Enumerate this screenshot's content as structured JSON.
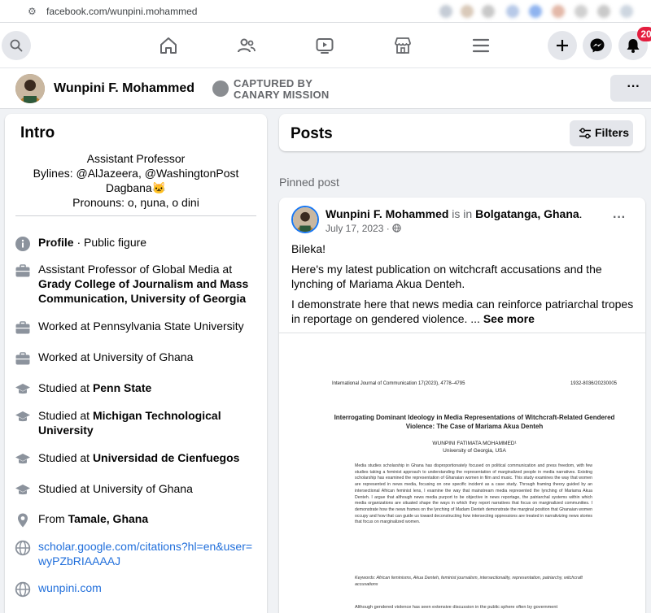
{
  "browser": {
    "url": "facebook.com/wunpini.mohammed"
  },
  "nav": {
    "notification_count": "20"
  },
  "profile": {
    "name": "Wunpini F. Mohammed"
  },
  "stamp": {
    "line1": "CAPTURED BY",
    "line2": "CANARY MISSION"
  },
  "intro": {
    "title": "Intro",
    "bio": [
      "Assistant Professor",
      "Bylines: @AlJazeera, @WashingtonPost",
      "Dagbana🐱",
      "Pronouns: o, ŋuna, o dini"
    ],
    "profile_label": "Profile",
    "profile_suffix": " · Public figure",
    "work1_prefix": "Assistant Professor of Global Media at ",
    "work1_bold": "Grady College of Journalism and Mass Communication, University of Georgia",
    "work2": "Worked at Pennsylvania State University",
    "work3": "Worked at University of Ghana",
    "edu1_prefix": "Studied at ",
    "edu1_bold": "Penn State",
    "edu2_prefix": "Studied at ",
    "edu2_bold": "Michigan Technological University",
    "edu3_prefix": "Studied at ",
    "edu3_bold": "Universidad de Cienfuegos",
    "edu4": "Studied at University of Ghana",
    "from_prefix": "From ",
    "from_bold": "Tamale, Ghana",
    "link1": "scholar.google.com/citations?hl=en&user=wyPZbRIAAAAJ",
    "link2": "wunpini.com"
  },
  "posts": {
    "title": "Posts",
    "filters_label": "Filters",
    "pinned_label": "Pinned post",
    "author": "Wunpini F. Mohammed",
    "is_in": " is in ",
    "location": "Bolgatanga, Ghana",
    "period": ".",
    "date": "July 17, 2023 · ",
    "p1": "Bileka!",
    "p2": "Here's my latest publication on witchcraft accusations and the lynching of Mariama Akua Denteh.",
    "p3": "I demonstrate here that news media can reinforce patriarchal tropes in reportage on gendered violence. ...",
    "see_more": " See more"
  },
  "document": {
    "journal": "International Journal of Communication 17(2023), 4778–4795",
    "issn": "1932-8036/20230005",
    "title": "Interrogating Dominant Ideology in Media Representations of Witchcraft-Related Gendered Violence: The Case of Mariama Akua Denteh",
    "author": "WUNPINI FATIMATA MOHAMMED¹",
    "affiliation": "University of Georgia, USA",
    "abstract": "Media studies scholarship in Ghana has disproportionately focused on political communication and press freedom, with few studies taking a feminist approach to understanding the representation of marginalized people in media narratives. Existing scholarship has examined the representation of Ghanaian women in film and music. This study examines the way that women are represented in news media, focusing on one specific incident as a case study. Through framing theory guided by an intersectional African feminist lens, I examine the way that mainstream media represented the lynching of Mariama Akua Denteh. I argue that although news media purport to be objective in news reportage, the patriarchal systems within which media organizations are situated shape the ways in which they report narratives that focus on marginalized communities. I demonstrate how the news frames on the lynching of Madam Denteh demonstrate the marginal position that Ghanaian women occupy and how that can guide us toward deconstructing how intersecting oppressions are treated in narrativizing news stories that focus on marginalized women.",
    "keywords": "Keywords: African feminisms, Akua Denteh, feminist journalism, intersectionality, representation, patriarchy, witchcraft accusations",
    "footer": "Although gendered violence has seen extensive discussion in the public sphere often by government"
  }
}
